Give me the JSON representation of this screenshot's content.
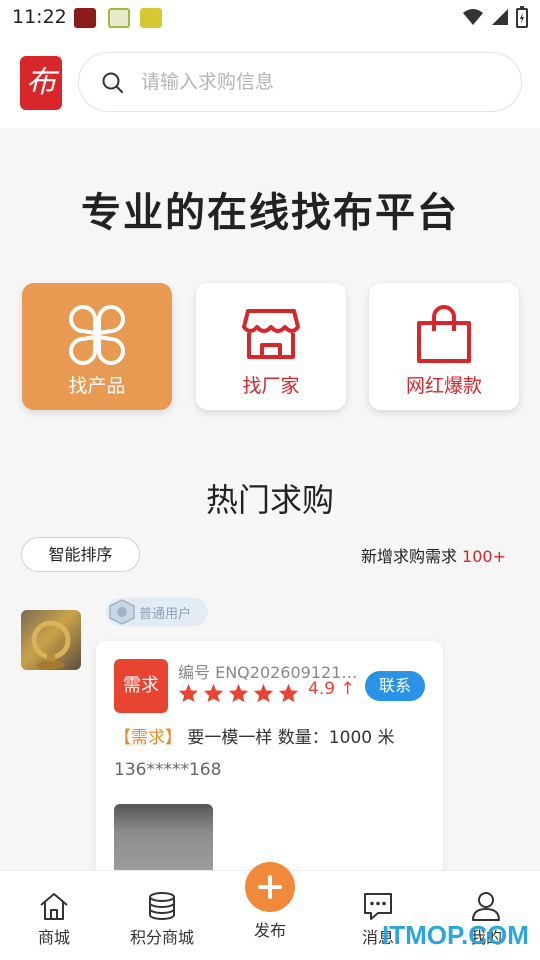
{
  "status_bar": {
    "time": "11:22"
  },
  "search": {
    "placeholder": "请输入求购信息"
  },
  "logo": {
    "glyph": "布"
  },
  "hero": {
    "title": "专业的在线找布平台"
  },
  "categories": [
    {
      "label": "找产品",
      "icon": "clover-icon",
      "active": true
    },
    {
      "label": "找厂家",
      "icon": "shop-icon",
      "active": false
    },
    {
      "label": "网红爆款",
      "icon": "shopping-bag-icon",
      "active": false
    }
  ],
  "hot": {
    "title": "热门求购",
    "sort_label": "智能排序",
    "new_label": "新增求购需求",
    "new_count": "100+"
  },
  "post": {
    "user_badge": "普通用户",
    "tag": "需求",
    "code": "编号 ENQ202609121…",
    "rating": "4.9 ↑",
    "rating_value": 4.9,
    "stars": 5,
    "contact_label": "联系",
    "desc_tag": "【需求】",
    "desc_text": "要一模一样  数量：1000 米",
    "phone": "136*****168"
  },
  "nav": {
    "items": [
      {
        "label": "商城",
        "icon": "home-icon"
      },
      {
        "label": "积分商城",
        "icon": "coins-icon"
      },
      {
        "label": "发布",
        "icon": "plus-icon"
      },
      {
        "label": "消息",
        "icon": "message-icon"
      },
      {
        "label": "我的",
        "icon": "user-icon"
      }
    ]
  },
  "watermark": "ITMOP.COM",
  "colors": {
    "brand_red": "#d9262a",
    "accent_orange": "#e89a52",
    "contact_blue": "#2a93e8",
    "star_red": "#e94332"
  }
}
